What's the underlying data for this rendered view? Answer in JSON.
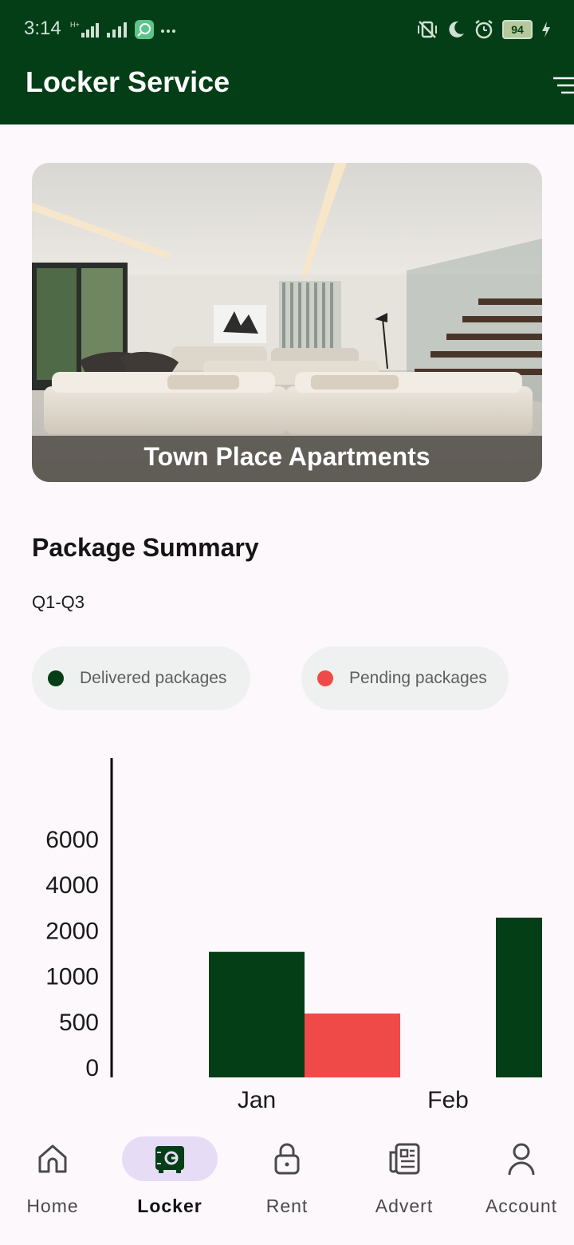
{
  "status_bar": {
    "time": "3:14",
    "battery": "94",
    "icons": [
      "hplus-signal-icon",
      "signal-icon",
      "app-notification-icon",
      "more-icon",
      "vibrate-off-icon",
      "moon-icon",
      "alarm-icon",
      "battery-icon",
      "charging-icon"
    ]
  },
  "app_bar": {
    "title": "Locker Service",
    "action_icon": "filter-icon"
  },
  "hero": {
    "caption": "Town Place Apartments",
    "image": "apartment-living-room-photo"
  },
  "summary": {
    "title": "Package Summary",
    "period": "Q1-Q3"
  },
  "legend": [
    {
      "label": "Delivered packages",
      "color": "#043e16"
    },
    {
      "label": "Pending packages",
      "color": "#f04a48"
    }
  ],
  "chart_data": {
    "type": "bar",
    "categories": [
      "Jan",
      "Feb"
    ],
    "y_tick_labels": [
      "0",
      "500",
      "1000",
      "2000",
      "4000",
      "6000"
    ],
    "series": [
      {
        "name": "Delivered packages",
        "color": "#043e16",
        "values": [
          1750,
          3000
        ]
      },
      {
        "name": "Pending packages",
        "color": "#f04a48",
        "values": [
          700,
          null
        ]
      }
    ],
    "grid": false
  },
  "bottom_nav": [
    {
      "label": "Home",
      "icon": "home-icon",
      "active": false
    },
    {
      "label": "Locker",
      "icon": "locker-icon",
      "active": true
    },
    {
      "label": "Rent",
      "icon": "lock-icon",
      "active": false
    },
    {
      "label": "Advert",
      "icon": "newspaper-icon",
      "active": false
    },
    {
      "label": "Account",
      "icon": "person-icon",
      "active": false
    }
  ]
}
